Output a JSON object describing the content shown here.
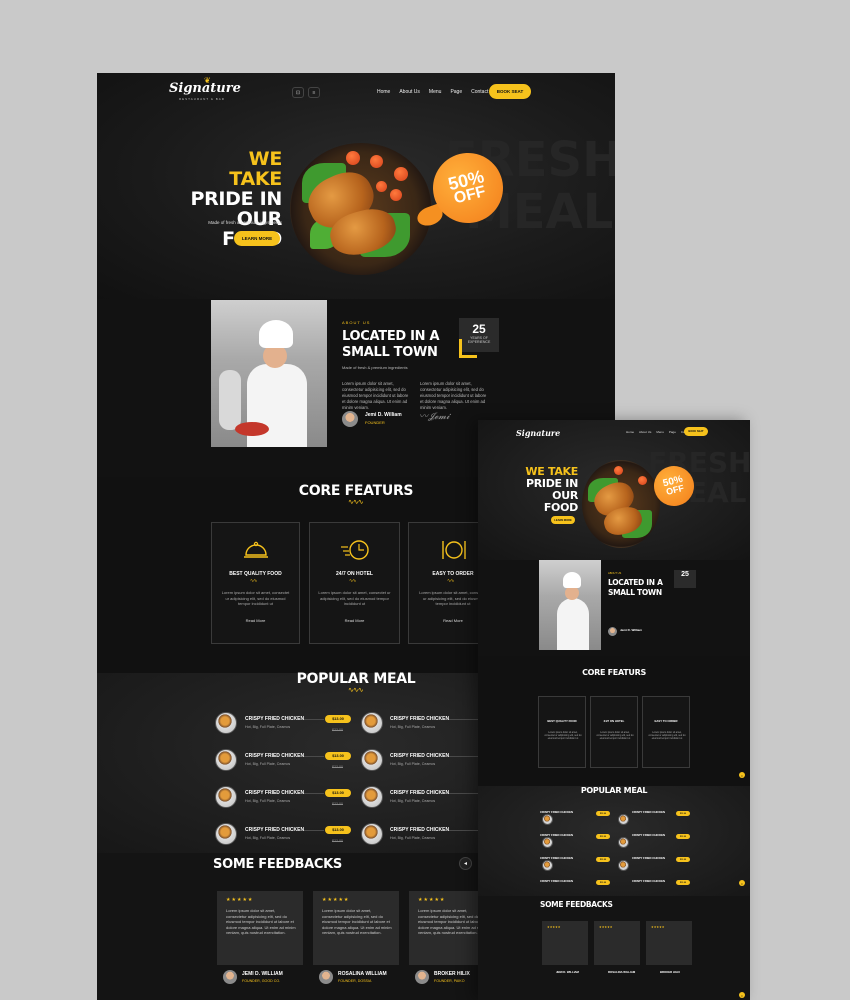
{
  "brand": {
    "name": "Signature",
    "tagline": "RESTAURANT & BAR"
  },
  "nav": {
    "links": [
      "Home",
      "About Us",
      "Menu",
      "Page",
      "Contact"
    ],
    "book_label": "BOOK SEAT"
  },
  "hero": {
    "line1": "WE TAKE",
    "line2": "PRIDE IN",
    "line3": "OUR FOOD",
    "subtitle": "Made of fresh & premium ingredients",
    "button": "LEARN MORE",
    "badge_pct": "50%",
    "badge_off": "OFF",
    "ghost1": "FRESH",
    "ghost2": "MEAL"
  },
  "about": {
    "tag": "ABOUT US",
    "title": "LOCATED IN A SMALL TOWN",
    "subtitle": "Made of fresh & premium ingredients",
    "years": "25",
    "years_label": "YEARS OF EXPERIENCE",
    "para1": "Lorem ipsum dolor sit amet, consectetur adipisicing elit, sed do eiusmod tempor incididunt ut labore et dolore magna aliqua. Ut enim ad minim veniam.",
    "para2": "Lorem ipsum dolor sit amet, consectetur adipisicing elit, sed do eiusmod tempor incididunt ut labore et dolore magna aliqua. Ut enim ad minim veniam.",
    "founder_name": "Jemi D. William",
    "founder_role": "FOUNDER"
  },
  "features": {
    "title": "CORE FEATURS",
    "items": [
      {
        "title": "BEST QUALITY FOOD",
        "text": "Lorem ipsum dolor sit amet, consectet ur adipisicing elit, sed do eiusmod tempor incididunt ut",
        "more": "Read More",
        "icon": "cloche-icon"
      },
      {
        "title": "24/7 ON HOTEL",
        "text": "Lorem ipsum dolor sit amet, consectet ur adipisicing elit, sed do eiusmod tempor incididunt ut",
        "more": "Read More",
        "icon": "fast-clock-icon"
      },
      {
        "title": "EASY TO ORDER",
        "text": "Lorem ipsum dolor sit amet, consectet ur adipisicing elit, sed do eiusmod tempor incididunt ut",
        "more": "Read More",
        "icon": "cutlery-plate-icon"
      }
    ]
  },
  "meals": {
    "title": "POPULAR MEAL",
    "items": [
      {
        "name": "CRISPY FRIED CHICKEN",
        "desc": "Hot, Big, Full Plate, Ceamos",
        "price": "$13.00",
        "old": "$23.00"
      },
      {
        "name": "CRISPY FRIED CHICKEN",
        "desc": "Hot, Big, Full Plate, Ceamos",
        "price": "$13.00",
        "old": "$23.00"
      },
      {
        "name": "CRISPY FRIED CHICKEN",
        "desc": "Hot, Big, Full Plate, Ceamos",
        "price": "$13.00",
        "old": "$23.00"
      },
      {
        "name": "CRISPY FRIED CHICKEN",
        "desc": "Hot, Big, Full Plate, Ceamos",
        "price": "$13.00",
        "old": "$23.00"
      },
      {
        "name": "CRISPY FRIED CHICKEN",
        "desc": "Hot, Big, Full Plate, Ceamos",
        "price": "$13.00",
        "old": "$23.00"
      },
      {
        "name": "CRISPY FRIED CHICKEN",
        "desc": "Hot, Big, Full Plate, Ceamos",
        "price": "$13.00",
        "old": "$23.00"
      },
      {
        "name": "CRISPY FRIED CHICKEN",
        "desc": "Hot, Big, Full Plate, Ceamos",
        "price": "$13.00",
        "old": "$23.00"
      },
      {
        "name": "CRISPY FRIED CHICKEN",
        "desc": "Hot, Big, Full Plate, Ceamos",
        "price": "$13.00",
        "old": "$23.00"
      }
    ]
  },
  "feedback": {
    "title": "SOME FEEDBACKS",
    "stars": "★★★★★",
    "text": "Lorem ipsum dolor sit amet, consectetur adipisicing elit, sed do eiusmod tempor incididunt ut labore et dolore magna aliqua. Ut enim ad minim veniam, quis nostrud exercitation.",
    "people": [
      {
        "name": "JEMI D. WILLIAM",
        "role": "FOUNDER, GOOD CO."
      },
      {
        "name": "ROSALINA WILLIAM",
        "role": "FOUNDER, DOSSIA"
      },
      {
        "name": "BROKER HILIX",
        "role": "FOUNDER, PAIKO"
      }
    ]
  },
  "colors": {
    "accent": "#f6c21c",
    "badge": "#f59021",
    "dark": "#151515"
  }
}
